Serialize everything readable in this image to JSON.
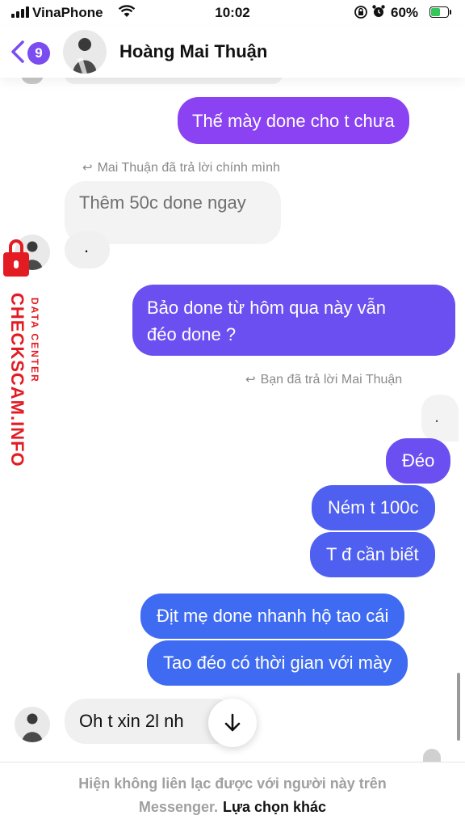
{
  "status_bar": {
    "carrier": "VinaPhone",
    "time": "10:02",
    "battery": "60%",
    "battery_level": 0.6,
    "icons": [
      "signal-icon",
      "wifi-icon",
      "orientation-lock-icon",
      "alarm-icon",
      "battery-charging-icon"
    ]
  },
  "header": {
    "back_count": "9",
    "contact_name": "Hoàng Mai Thuận",
    "accent_color": "#7b4cf0"
  },
  "messages": [
    {
      "id": "m1",
      "side": "out",
      "text": "Thế mày done cho t chưa"
    },
    {
      "id": "n1",
      "type": "reply_note",
      "text": "Mai Thuận đã trả lời chính mình"
    },
    {
      "id": "m2",
      "side": "in",
      "text": "Thêm 50c done ngay"
    },
    {
      "id": "m3",
      "side": "in",
      "text": "."
    },
    {
      "id": "m4",
      "side": "out",
      "lines": [
        "Bảo done từ hôm qua này vẫn",
        "đéo done ?"
      ]
    },
    {
      "id": "n2",
      "type": "reply_note",
      "text": "Bạn đã trả lời Mai Thuận"
    },
    {
      "id": "m5",
      "side": "out_quoted",
      "text": "."
    },
    {
      "id": "m6",
      "side": "out",
      "text": "Đéo"
    },
    {
      "id": "m7",
      "side": "out",
      "text": "Ném t 100c"
    },
    {
      "id": "m8",
      "side": "out",
      "text": "T đ cần biết"
    },
    {
      "id": "m9",
      "side": "out",
      "text": "Địt mẹ done nhanh hộ tao cái"
    },
    {
      "id": "m10",
      "side": "out",
      "text": "Tao đéo có thời gian với mày"
    },
    {
      "id": "m11",
      "side": "in",
      "text": "Oh t xin 2l nh"
    }
  ],
  "watermark": {
    "main": "CHECKSCAM.INFO",
    "sub": "DATA CENTER",
    "color": "#e31b23"
  },
  "footer": {
    "line1": "Hiện không liên lạc được với người này trên",
    "line2_prefix": "Messenger.",
    "link": "Lựa chọn khác"
  }
}
